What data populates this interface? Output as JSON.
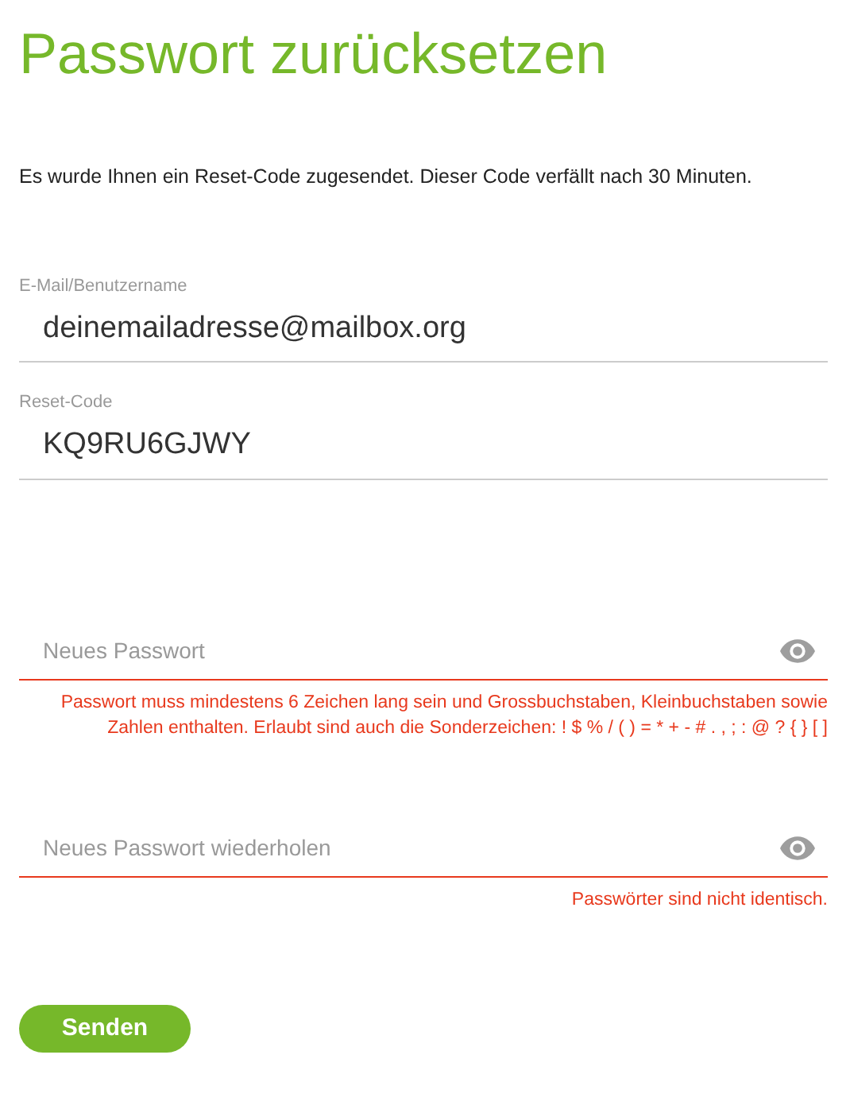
{
  "title": "Passwort zurücksetzen",
  "intro": "Es wurde Ihnen ein Reset-Code zugesendet. Dieser Code verfällt nach 30 Minuten.",
  "fields": [
    {
      "kind": "text",
      "label": "E-Mail/Benutzername",
      "value": "deinemailadresse@mailbox.org"
    },
    {
      "kind": "text",
      "label": "Reset-Code",
      "value": "KQ9RU6GJWY"
    },
    {
      "kind": "password",
      "placeholder": "Neues Passwort",
      "error": "Passwort muss mindestens 6 Zeichen lang sein und Grossbuchstaben, Kleinbuchstaben sowie Zahlen enthalten. Erlaubt sind auch die Sonderzeichen: ! $ % / ( ) = * + - # . , ; : @ ? { } [ ]"
    },
    {
      "kind": "password",
      "placeholder": "Neues Passwort wiederholen",
      "error": "Passwörter sind nicht identisch."
    }
  ],
  "submit": "Senden"
}
